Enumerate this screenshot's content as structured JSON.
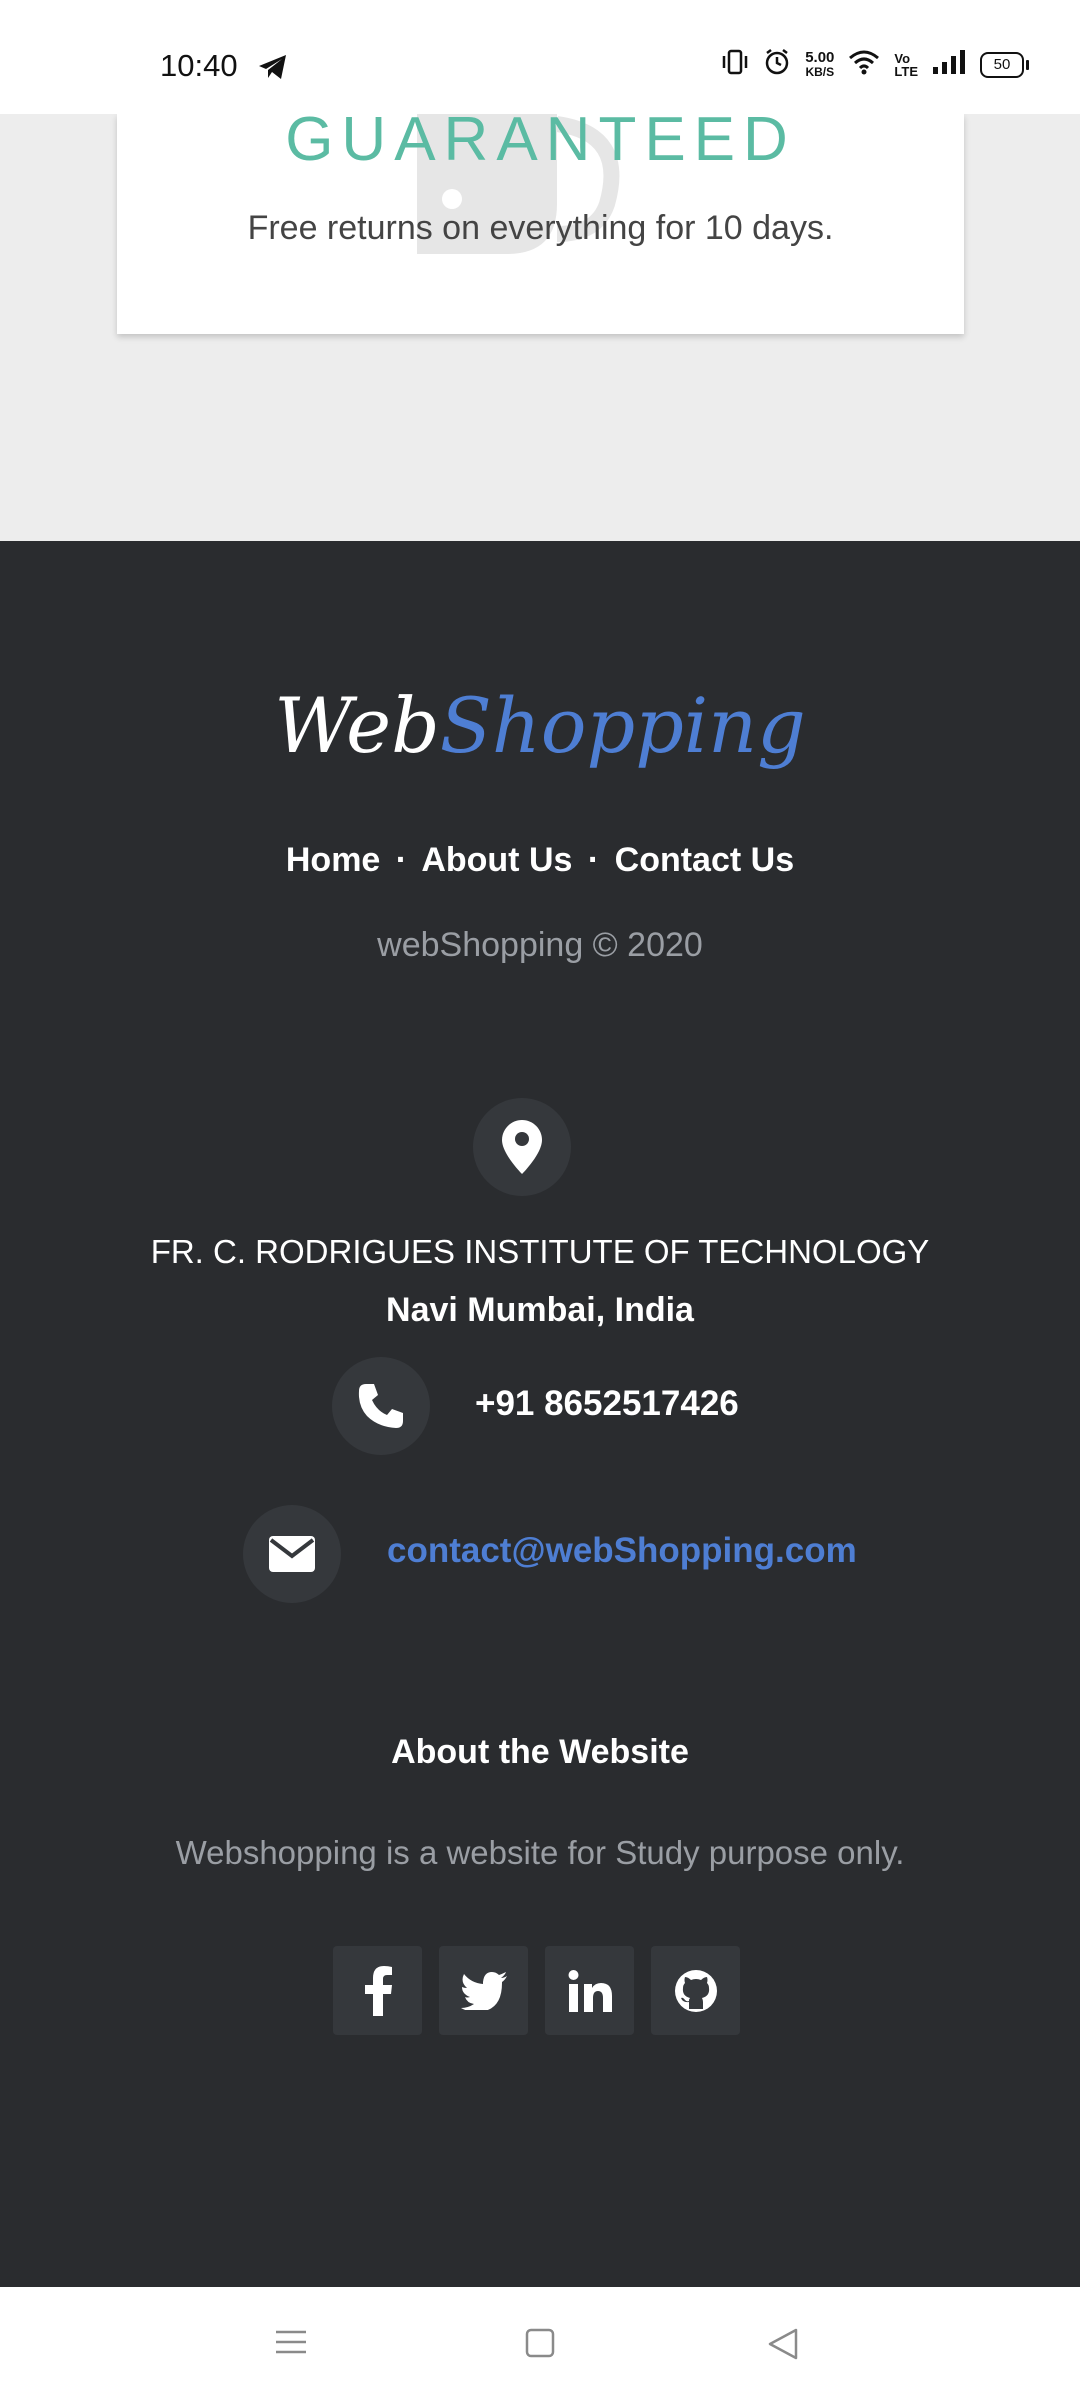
{
  "status_bar": {
    "time": "10:40",
    "speed_value": "5.00",
    "speed_unit": "KB/S",
    "volte_line1": "Vo",
    "volte_line2": "LTE",
    "battery": "50",
    "icons": [
      "telegram-icon",
      "vibrate-icon",
      "alarm-icon",
      "wifi-icon",
      "signal-icon"
    ]
  },
  "card": {
    "title": "GUARANTEED",
    "text": "Free returns on everything for 10 days."
  },
  "footer": {
    "logo_part1": "Web",
    "logo_part2": "Shopping",
    "nav": {
      "home": "Home",
      "about": "About Us",
      "contact": "Contact Us",
      "separator": "·"
    },
    "copyright": "webShopping © 2020",
    "address_line1": "FR. C. RODRIGUES INSTITUTE OF TECHNOLOGY",
    "address_line2": "Navi Mumbai, India",
    "phone": "+91 8652517426",
    "email": "contact@webShopping.com",
    "about_title": "About the Website",
    "about_text": "Webshopping is a website for Study purpose only.",
    "social_icons": [
      "facebook-icon",
      "twitter-icon",
      "linkedin-icon",
      "github-icon"
    ]
  },
  "colors": {
    "accent_green": "#5bbba3",
    "brand_blue": "#4e7ed3",
    "footer_bg": "#2a2c2f"
  },
  "system_nav": [
    "menu-icon",
    "home-icon",
    "back-icon"
  ]
}
